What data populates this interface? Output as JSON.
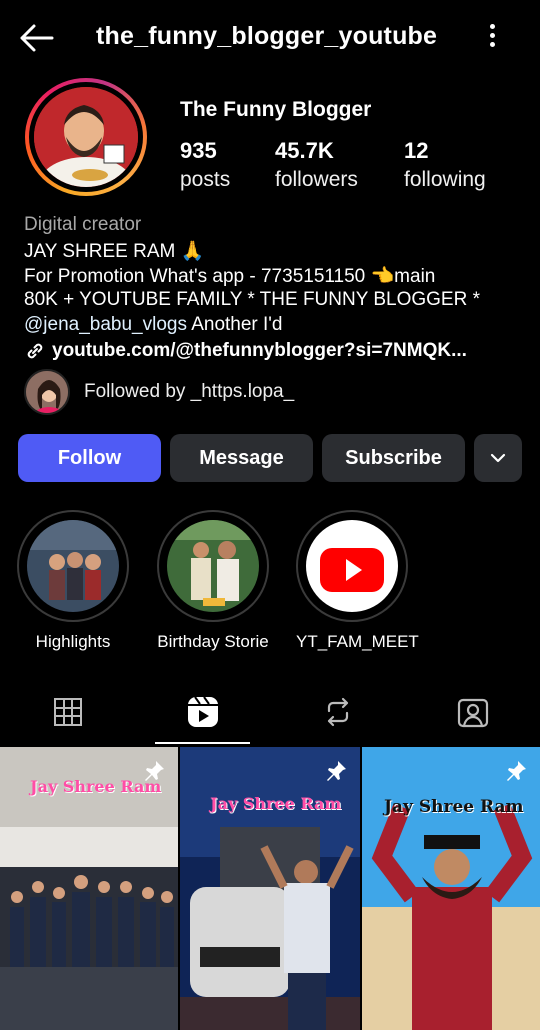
{
  "header": {
    "handle": "the_funny_blogger_youtube"
  },
  "profile": {
    "name": "The Funny Blogger",
    "stats": [
      {
        "value": "935",
        "label": "posts"
      },
      {
        "value": "45.7K",
        "label": "followers"
      },
      {
        "value": "12",
        "label": "following"
      }
    ],
    "category": "Digital creator",
    "bio": [
      "JAY SHREE RAM 🙏",
      "For Promotion What's app - 7735151150 👈main",
      "80K + YOUTUBE FAMILY * THE FUNNY BLOGGER *"
    ],
    "mention": "@jena_babu_vlogs",
    "mention_suffix": " Another I'd",
    "link": "youtube.com/@thefunnyblogger?si=7NMQK...",
    "followed_by": "Followed by _https.lopa_"
  },
  "actions": {
    "follow": "Follow",
    "message": "Message",
    "subscribe": "Subscribe"
  },
  "highlights": [
    {
      "label": "Highlights"
    },
    {
      "label": "Birthday Storie"
    },
    {
      "label": "YT_FAM_MEET"
    }
  ],
  "posts": [
    {
      "caption": "Jay Shree Ram"
    },
    {
      "caption": "Jay Shree Ram"
    },
    {
      "caption": "Jay Shree Ram"
    }
  ],
  "colors": {
    "accent": "#4f5bf5",
    "button": "#2b2d31",
    "background": "#000000",
    "youtube_red": "#ff0000"
  },
  "icons": [
    "back-arrow-icon",
    "more-vertical-icon",
    "link-icon",
    "chevron-down-icon",
    "grid-icon",
    "reels-icon",
    "reposts-icon",
    "tagged-icon",
    "pin-icon"
  ]
}
